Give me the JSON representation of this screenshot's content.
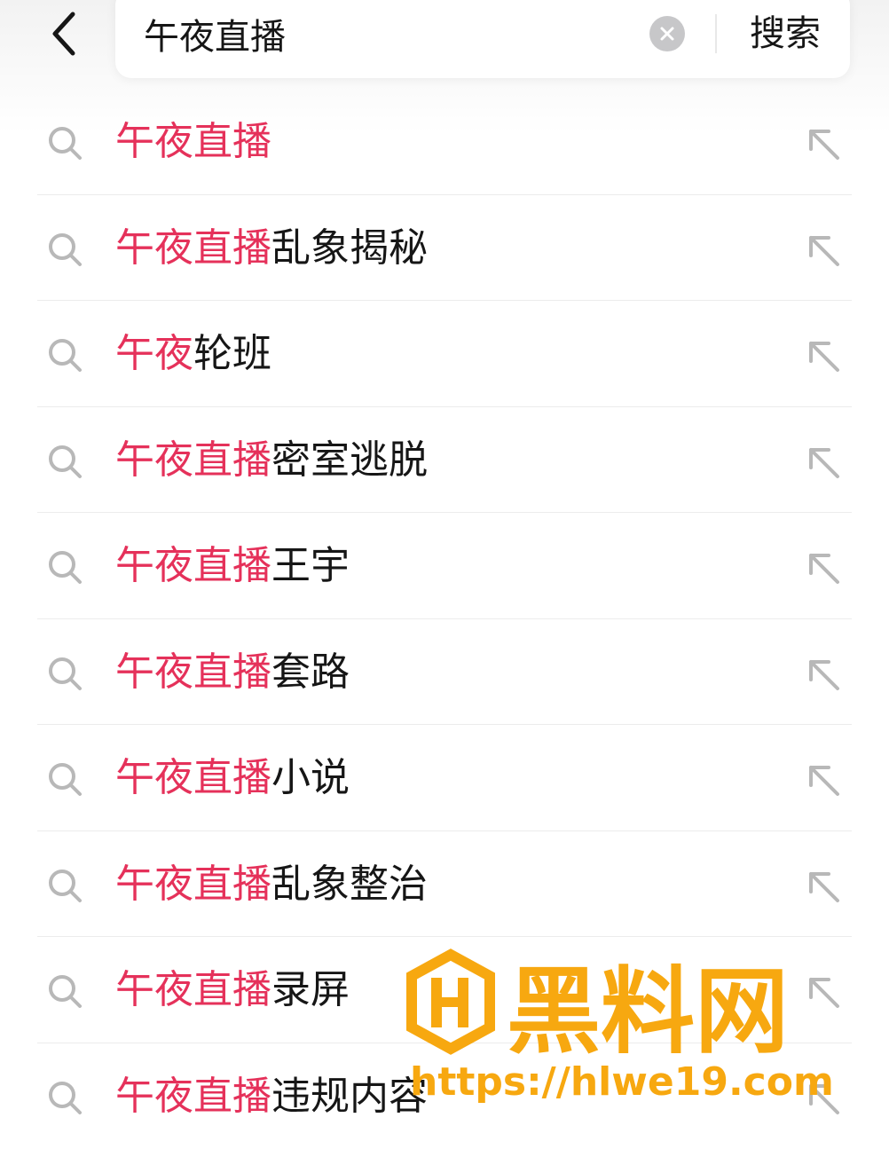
{
  "header": {
    "search_value": "午夜直播",
    "search_button": "搜索",
    "back_icon": "chevron-left-icon",
    "clear_icon": "clear-circle-icon"
  },
  "suggestions": [
    {
      "highlight": "午夜直播",
      "rest": ""
    },
    {
      "highlight": "午夜直播",
      "rest": "乱象揭秘"
    },
    {
      "highlight": "午夜",
      "rest": "轮班"
    },
    {
      "highlight": "午夜直播",
      "rest": "密室逃脱"
    },
    {
      "highlight": "午夜直播",
      "rest": "王宇"
    },
    {
      "highlight": "午夜直播",
      "rest": "套路"
    },
    {
      "highlight": "午夜直播",
      "rest": "小说"
    },
    {
      "highlight": "午夜直播",
      "rest": "乱象整治"
    },
    {
      "highlight": "午夜直播",
      "rest": "录屏"
    },
    {
      "highlight": "午夜直播",
      "rest": "违规内容"
    }
  ],
  "watermark": {
    "title": "黑料网",
    "url": "https://hlwe19.com"
  },
  "colors": {
    "highlight": "#e5315a",
    "text": "#161616",
    "icon": "#b8b8b8",
    "watermark": "#f7a810"
  }
}
